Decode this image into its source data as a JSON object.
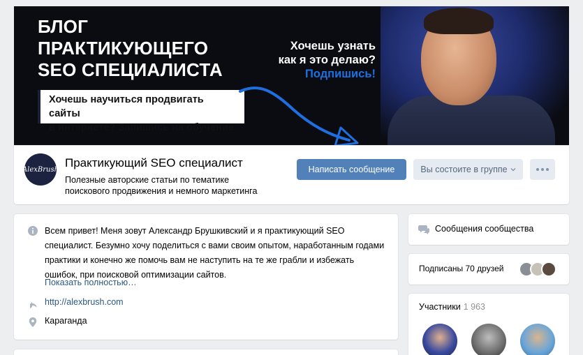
{
  "cover": {
    "title_lines": [
      "БЛОГ",
      "ПРАКТИКУЮЩЕГО",
      "SEO СПЕЦИАЛИСТА"
    ],
    "box_lines": [
      "Хочешь научиться продвигать сайты",
      "в интернете? Запишись на обучение"
    ],
    "cta_lines": [
      "Хочешь узнать",
      "как я это делаю?"
    ],
    "cta_sub": "Подпишись!",
    "accent_color": "#1e6fe0"
  },
  "header": {
    "avatar_text": "AlexBrush",
    "group_name": "Практикующий SEO специалист",
    "status_line1": "Полезные авторские статьи по тематике",
    "status_line2": "поискового продвижения и немного маркетинга",
    "message_button": "Написать сообщение",
    "member_button": "Вы состоите в группе",
    "more_icon": "more-dots-icon"
  },
  "info": {
    "description": "Всем привет! Меня зовут Александр Брушкивский и я практикующий SEO специалист. Безумно хочу поделиться с вами своим опытом, наработанным годами практики и конечно же помочь вам не наступить на те же грабли и избежать ошибок, при поисковой оптимизации сайтов.",
    "show_more": "Показать полностью…",
    "link": "http://alexbrush.com",
    "city": "Караганда",
    "icons": [
      "info-icon",
      "link-icon",
      "location-icon"
    ]
  },
  "sidebar": {
    "messages_label": "Сообщения сообщества",
    "friends_label": "Подписаны 70 друзей",
    "members_label": "Участники",
    "members_count": "1 963"
  },
  "colors": {
    "primary_button": "#5181b8",
    "secondary_button": "#e5ebf1",
    "link": "#2a5885",
    "page_bg": "#edeef0"
  }
}
